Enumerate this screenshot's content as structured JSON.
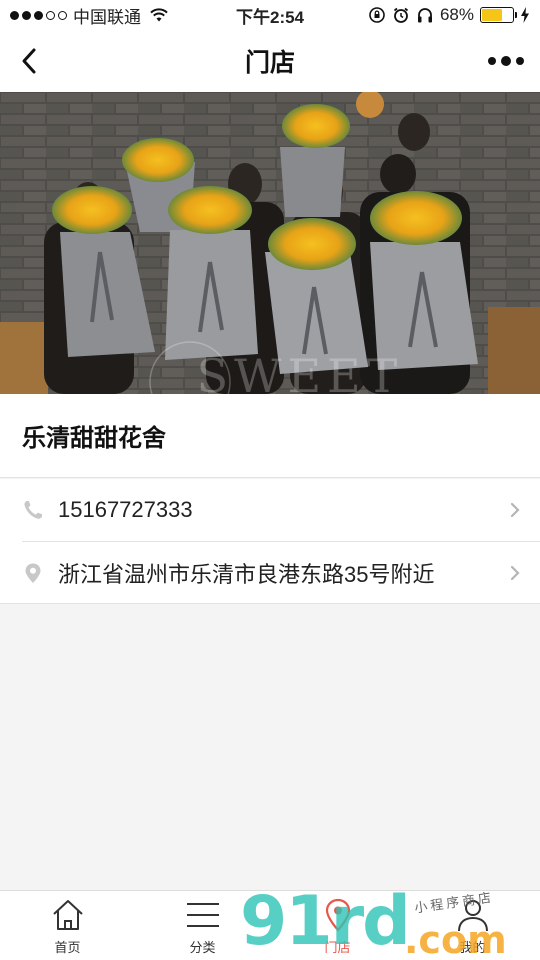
{
  "status_bar": {
    "carrier": "中国联通",
    "time": "下午2:54",
    "battery_percent": "68%",
    "battery_level": 0.68,
    "battery_color": "#f5c518"
  },
  "nav": {
    "title": "门店",
    "back_icon": "chevron-left-icon",
    "more_icon": "more-dots-icon"
  },
  "hero": {
    "watermark_text": "SWEET"
  },
  "shop": {
    "name": "乐清甜甜花舍",
    "phone": "15167727333",
    "address": "浙江省温州市乐清市良港东路35号附近"
  },
  "tabs": [
    {
      "label": "首页",
      "icon": "home-icon",
      "active": false
    },
    {
      "label": "分类",
      "icon": "menu-icon",
      "active": false
    },
    {
      "label": "门店",
      "icon": "location-pin-icon",
      "active": true
    },
    {
      "label": "我的",
      "icon": "user-icon",
      "active": false
    }
  ],
  "watermark": {
    "main": "91rd",
    "suffix": ".com",
    "subtitle": "小程序商店"
  },
  "colors": {
    "accent": "#e8574a",
    "watermark_teal": "#2ec4b6",
    "watermark_orange": "#f5a623"
  }
}
